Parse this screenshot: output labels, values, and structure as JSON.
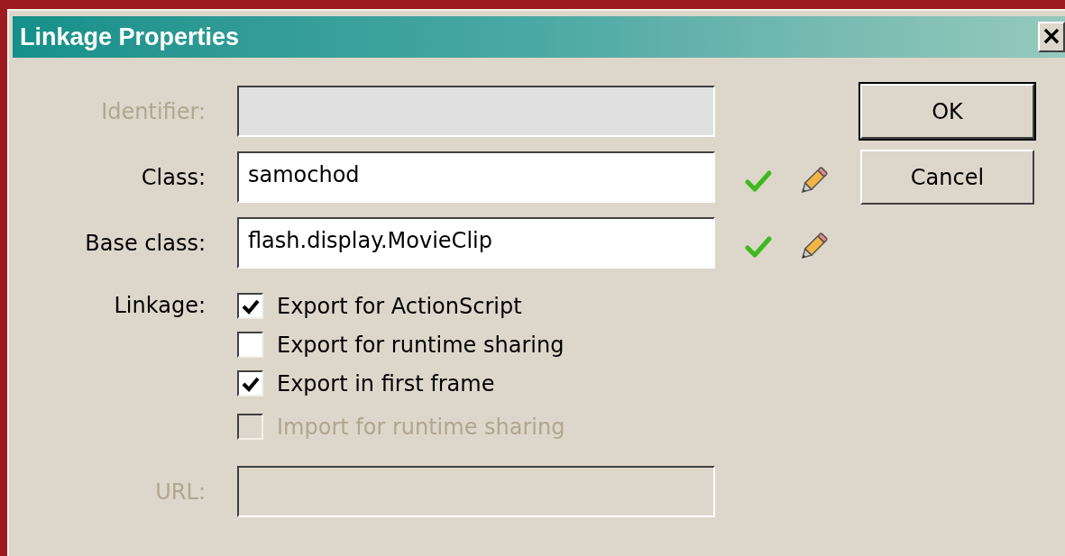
{
  "window": {
    "title": "Linkage Properties",
    "close": "×"
  },
  "rows": [
    {
      "kind": "field",
      "label": "Identifier:",
      "disabled": true
    },
    {
      "kind": "field",
      "label": "Class:",
      "value": "samochod",
      "disabled": false,
      "tools": true
    },
    {
      "kind": "field",
      "label": "Base class:",
      "value": "flash.display.MovieClip",
      "disabled": false,
      "tools": true
    },
    {
      "kind": "checks",
      "label": "Linkage:",
      "options": [
        {
          "label": "Export for ActionScript",
          "checked": true,
          "disabled": false
        },
        {
          "label": "Export for runtime sharing",
          "checked": false,
          "disabled": false
        },
        {
          "label": "Export in first frame",
          "checked": true,
          "disabled": false
        },
        {
          "label": "Import for runtime sharing",
          "checked": false,
          "disabled": true
        }
      ]
    },
    {
      "kind": "field",
      "label": "URL:",
      "disabled": true
    }
  ],
  "buttons": [
    {
      "label": "OK",
      "default": true
    },
    {
      "label": "Cancel",
      "default": false
    }
  ]
}
